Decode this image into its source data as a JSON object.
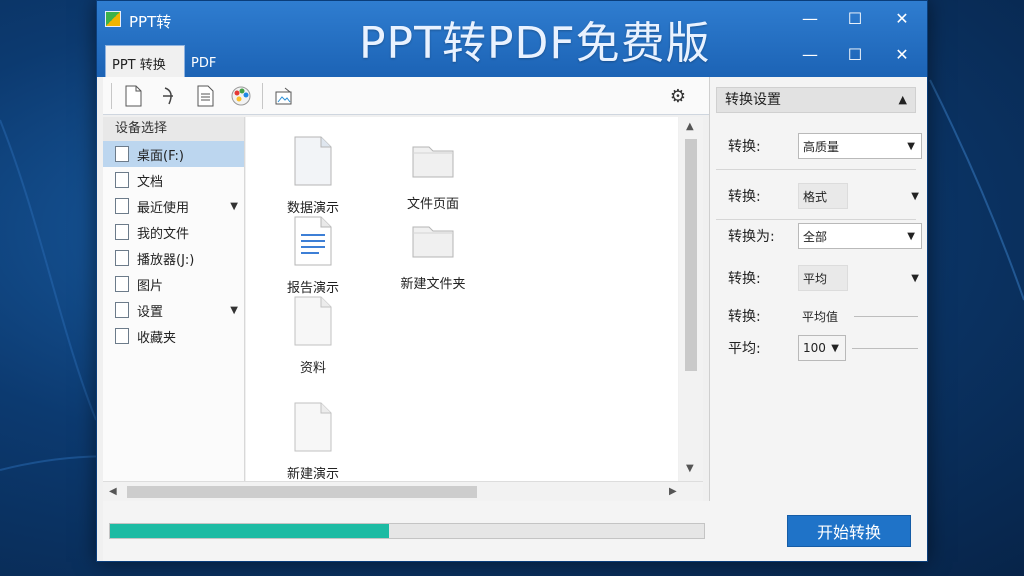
{
  "window": {
    "app_name": "PPT转",
    "banner": "PPT转PDF免费版",
    "controls": {
      "minimize": "—",
      "maximize": "☐",
      "close": "✕"
    }
  },
  "tabs": [
    {
      "label": "PPT 转换"
    },
    {
      "label": "PDF"
    }
  ],
  "toolbar": {
    "icons": [
      "new-file-icon",
      "convert-icon",
      "document-icon",
      "color-palette-icon",
      "image-edit-icon"
    ],
    "settings_icon": "gear-icon"
  },
  "nav": {
    "header": "设备选择",
    "items": [
      {
        "label": "桌面(F:)",
        "selected": true,
        "expandable": false
      },
      {
        "label": "文档",
        "selected": false,
        "expandable": false
      },
      {
        "label": "最近使用",
        "selected": false,
        "expandable": true
      },
      {
        "label": "我的文件",
        "selected": false,
        "expandable": false
      },
      {
        "label": "播放器(J:)",
        "selected": false,
        "expandable": false
      },
      {
        "label": "图片",
        "selected": false,
        "expandable": false
      },
      {
        "label": "设置",
        "selected": false,
        "expandable": true
      },
      {
        "label": "收藏夹",
        "selected": false,
        "expandable": false
      }
    ]
  },
  "files": [
    {
      "label": "数据演示",
      "type": "doc"
    },
    {
      "label": "文件页面",
      "type": "folder"
    },
    {
      "label": "报告演示",
      "type": "lines"
    },
    {
      "label": "新建文件夹",
      "type": "folder"
    },
    {
      "label": "资料",
      "type": "blank"
    },
    {
      "label": "新建演示",
      "type": "blank"
    }
  ],
  "settings_panel": {
    "header": "转换设置",
    "rows": [
      {
        "label": "转换:",
        "value": "高质量",
        "boxed": true
      },
      {
        "label": "转换:",
        "value": "格式",
        "boxed": false
      },
      {
        "label": "转换为:",
        "value": "全部",
        "boxed": true
      },
      {
        "label": "转换:",
        "value": "平均",
        "boxed": false
      },
      {
        "label": "转换:",
        "value": "平均值",
        "boxed": false
      },
      {
        "label": "平均:",
        "value": "100",
        "boxed": false
      }
    ]
  },
  "progress": {
    "fraction": 0.47
  },
  "start_button": "开始转换",
  "colors": {
    "titlebar": "#1c63b5",
    "accent": "#1f73c8",
    "progress": "#1dbba3"
  }
}
